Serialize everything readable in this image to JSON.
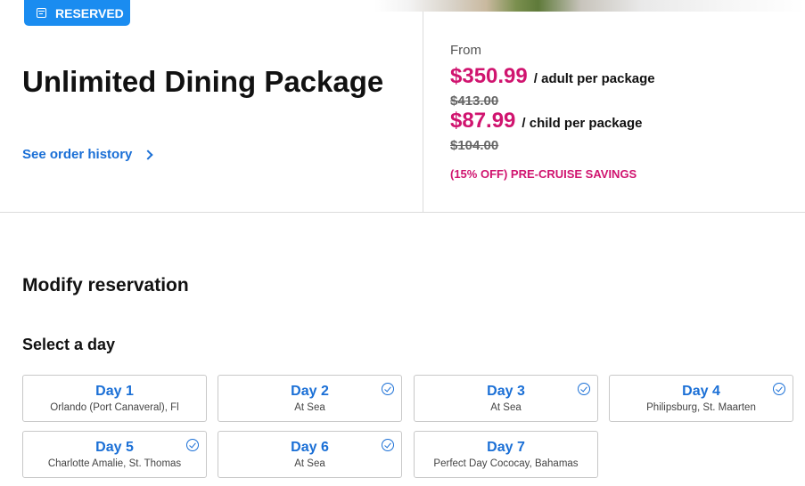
{
  "badge": {
    "label": "RESERVED",
    "icon": "calendar-icon"
  },
  "title": "Unlimited Dining Package",
  "history_link": "See order history",
  "pricing": {
    "from_label": "From",
    "adult_price": "$350.99",
    "adult_unit": "/ adult per package",
    "adult_original": "$413.00",
    "child_price": "$87.99",
    "child_unit": "/ child per package",
    "child_original": "$104.00",
    "savings": "(15% OFF) PRE-CRUISE SAVINGS"
  },
  "modify_heading": "Modify reservation",
  "select_heading": "Select a day",
  "days": [
    {
      "label": "Day 1",
      "port": "Orlando (Port Canaveral), Fl",
      "checked": false
    },
    {
      "label": "Day 2",
      "port": "At Sea",
      "checked": true
    },
    {
      "label": "Day 3",
      "port": "At Sea",
      "checked": true
    },
    {
      "label": "Day 4",
      "port": "Philipsburg, St. Maarten",
      "checked": true
    },
    {
      "label": "Day 5",
      "port": "Charlotte Amalie, St. Thomas",
      "checked": true
    },
    {
      "label": "Day 6",
      "port": "At Sea",
      "checked": true
    },
    {
      "label": "Day 7",
      "port": "Perfect Day Cococay, Bahamas",
      "checked": false
    }
  ],
  "colors": {
    "accent_blue": "#1a6fd6",
    "badge_blue": "#1a8cf0",
    "price_pink": "#d0146f"
  }
}
